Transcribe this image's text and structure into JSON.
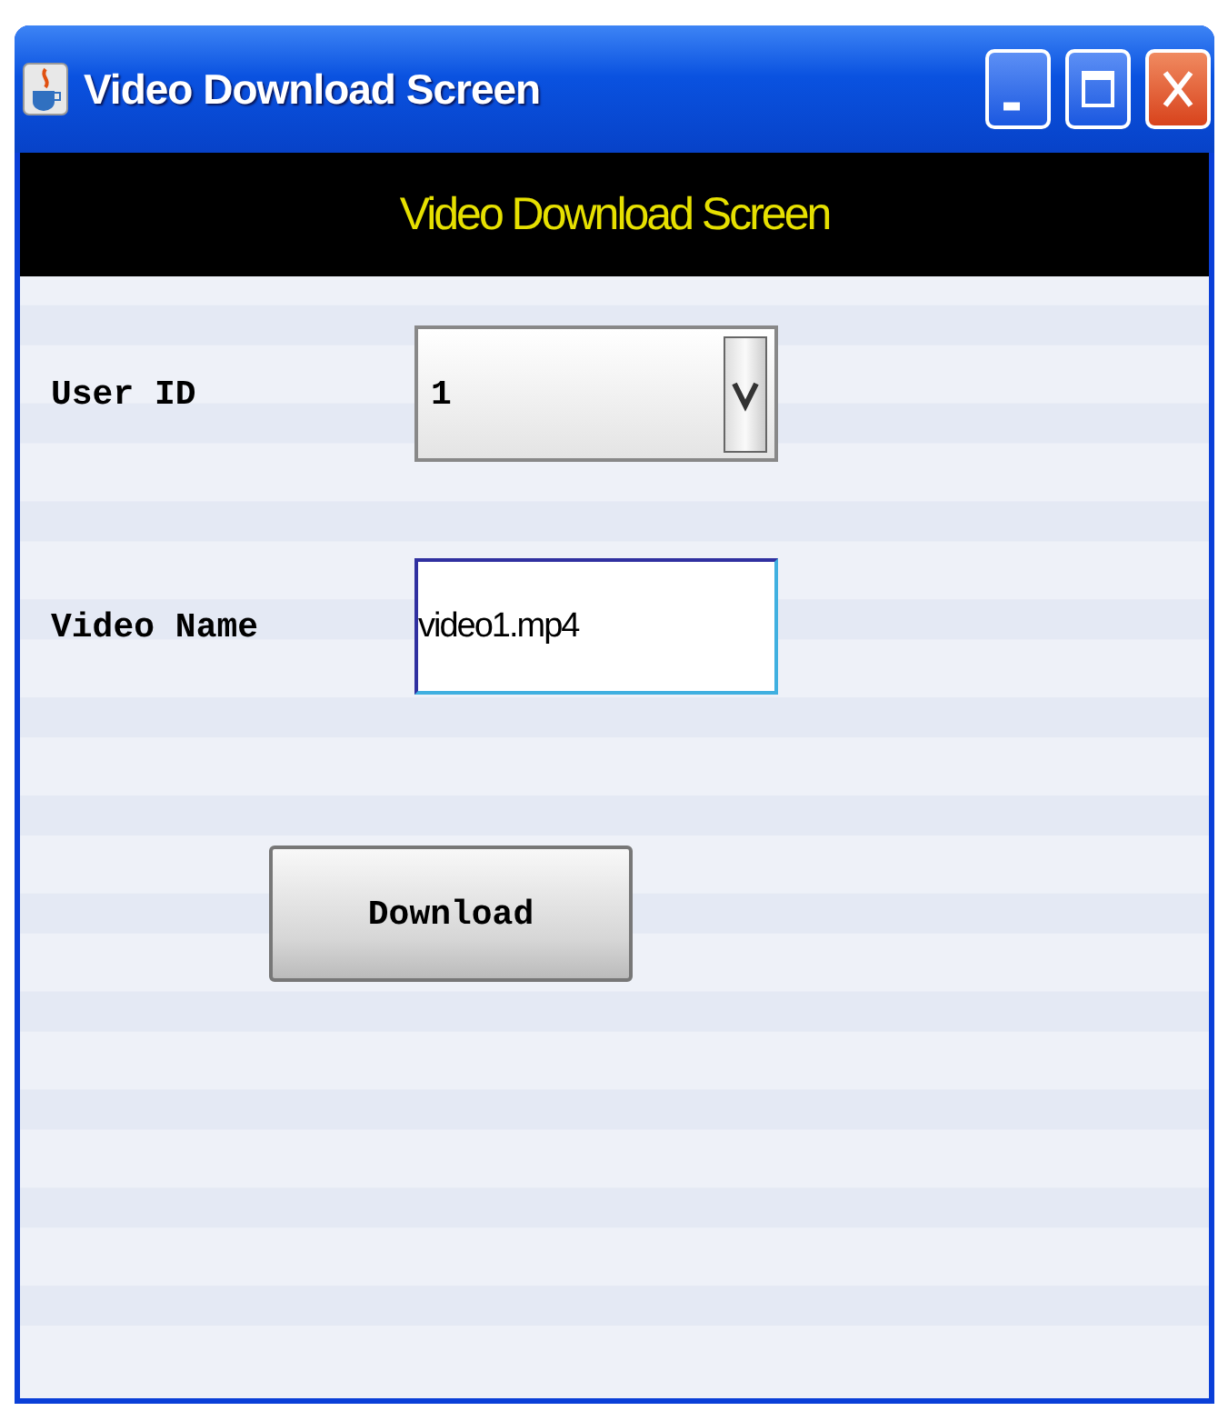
{
  "window": {
    "title": "Video Download Screen"
  },
  "header": {
    "title": "Video Download Screen"
  },
  "form": {
    "user_id": {
      "label": "User ID",
      "value": "1"
    },
    "video_name": {
      "label": "Video Name",
      "value": "video1.mp4"
    },
    "button": "Download"
  }
}
